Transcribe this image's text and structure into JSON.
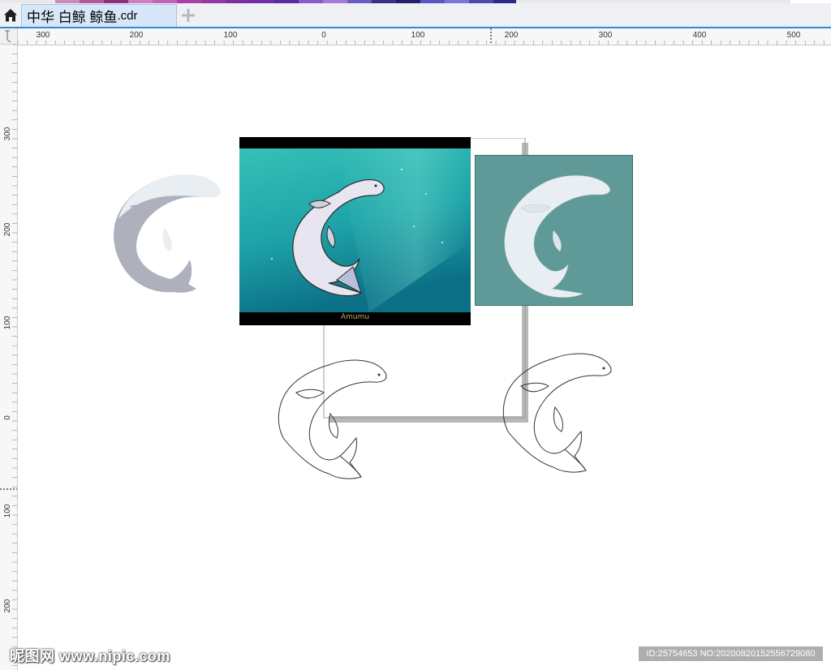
{
  "palette_colors": [
    "#e9e9e9",
    "#c98bb8",
    "#b9559a",
    "#8e2f7e",
    "#d07cc2",
    "#c464b9",
    "#ab3fa5",
    "#9439a4",
    "#7e2ea4",
    "#6e2fa8",
    "#5a2aa0",
    "#8a5ac6",
    "#a47cd8",
    "#6a5bc7",
    "#3c2f8c",
    "#26206b",
    "#5a57c4",
    "#7a78d6",
    "#4d4aae",
    "#2b2886",
    "#e9e9e9"
  ],
  "document": {
    "tab_title": "中华 白鲸 鲸鱼",
    "tab_ext": ".cdr",
    "home_icon": "home-icon",
    "add_icon": "plus-icon"
  },
  "rulers": {
    "horizontal_labels": [
      "300",
      "200",
      "100",
      "0",
      "100",
      "200",
      "300",
      "400",
      "500"
    ],
    "vertical_labels": [
      "300",
      "200",
      "100",
      "0",
      "100",
      "200"
    ]
  },
  "artwork": {
    "photo_caption": "Amumu"
  },
  "watermarks": {
    "left": "昵图网 www.nipic.com",
    "right": "ID:25754653 NO:20200820152556729080"
  },
  "colors": {
    "accent": "#2f8ad8",
    "tab_active": "#d7e6f8",
    "whale_silhouette": "#aeb0bb",
    "whale_light": "#e9eef2",
    "teal_card": "#5f9a99",
    "ocean_teal": "#2fb8b0"
  }
}
